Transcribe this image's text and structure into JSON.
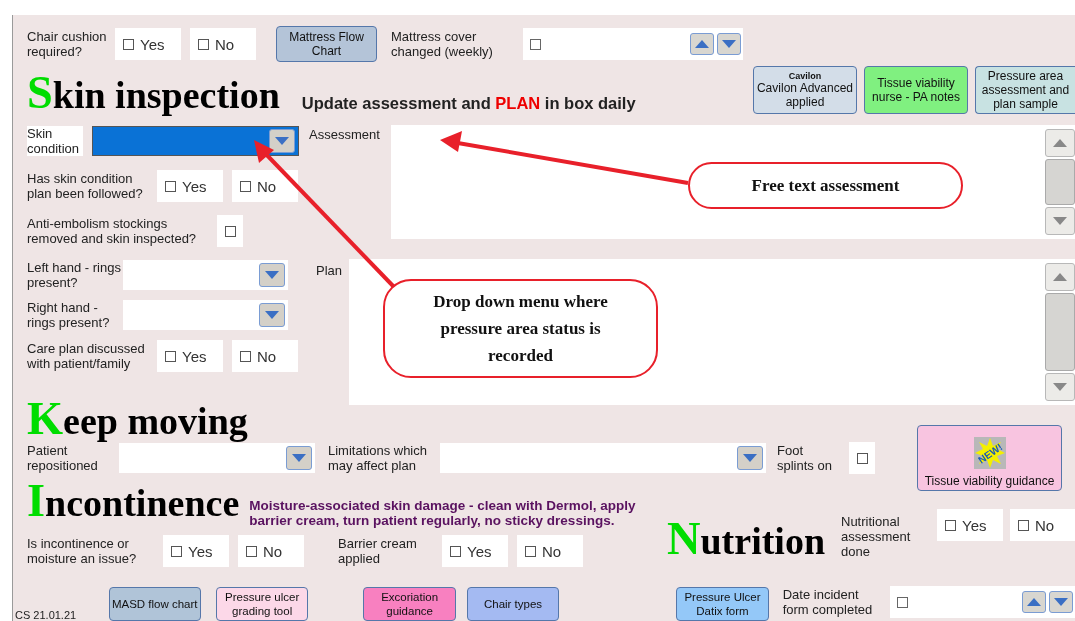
{
  "chair_cushion": {
    "label": "Chair cushion required?",
    "options": [
      {
        "label": "Yes",
        "checked": false
      },
      {
        "label": "No",
        "checked": false
      }
    ]
  },
  "mattress_flow_button": "Mattress Flow Chart",
  "mattress_cover": {
    "label": "Mattress cover changed (weekly)",
    "checked": false
  },
  "skin_inspection": {
    "heading": "Skin inspection",
    "instruction": {
      "before": "Update assessment and",
      "highlight": "PLAN",
      "after": "in box daily"
    }
  },
  "skin_buttons": [
    {
      "kind": "logo",
      "logo_text": "Cavilon",
      "label": "Cavilon Advanced applied",
      "color": "#d3dde8"
    },
    {
      "kind": "plain",
      "label": "Tissue viability nurse - PA notes",
      "color": "#80f080"
    },
    {
      "kind": "plain",
      "label": "Pressure area assessment and plan sample",
      "color": "#c8e2e2"
    }
  ],
  "skin_fields": [
    {
      "kind": "dropdown",
      "label": "Skin condition",
      "highlighted": true
    },
    {
      "kind": "yes_no",
      "label": "Has skin condition plan been followed?",
      "options": [
        {
          "label": "Yes",
          "checked": false
        },
        {
          "label": "No",
          "checked": false
        }
      ]
    },
    {
      "kind": "checkbox",
      "label": "Anti-embolism stockings removed and skin inspected?",
      "checked": false
    },
    {
      "kind": "dropdown",
      "label": "Left hand - rings present?",
      "highlighted": false
    },
    {
      "kind": "dropdown",
      "label": "Right hand - rings present?",
      "highlighted": false
    },
    {
      "kind": "yes_no",
      "label": "Care plan discussed with patient/family",
      "options": [
        {
          "label": "Yes",
          "checked": false
        },
        {
          "label": "No",
          "checked": false
        }
      ]
    }
  ],
  "assessment": {
    "label": "Assessment"
  },
  "plan": {
    "label": "Plan"
  },
  "keep_moving": {
    "heading": "Keep moving",
    "fields": [
      {
        "kind": "dropdown",
        "label": "Patient repositioned"
      },
      {
        "kind": "dropdown",
        "label": "Limitations which may affect plan"
      },
      {
        "kind": "checkbox",
        "label": "Foot splints on",
        "checked": false
      }
    ],
    "guidance_button": {
      "badge": "NEW!",
      "label": "Tissue viability guidance"
    }
  },
  "incontinence": {
    "heading": "Incontinence",
    "note": "Moisture-associated skin damage - clean with Dermol, apply barrier cream, turn patient regularly, no sticky dressings.",
    "fields": [
      {
        "label": "Is incontinence or moisture an issue?",
        "options": [
          {
            "label": "Yes",
            "checked": false
          },
          {
            "label": "No",
            "checked": false
          }
        ]
      },
      {
        "label": "Barrier cream applied",
        "options": [
          {
            "label": "Yes",
            "checked": false
          },
          {
            "label": "No",
            "checked": false
          }
        ]
      }
    ]
  },
  "nutrition": {
    "heading": "Nutrition",
    "field": {
      "label": "Nutritional assessment done",
      "options": [
        {
          "label": "Yes",
          "checked": false
        },
        {
          "label": "No",
          "checked": false
        }
      ]
    }
  },
  "bottom_buttons": [
    {
      "label": "MASD flow chart",
      "color": "#b0c4d8"
    },
    {
      "label": "Pressure ulcer grading tool",
      "color": "#fcd8e8"
    },
    {
      "label": "Excoriation guidance",
      "color": "#f880c0"
    },
    {
      "label": "Chair types",
      "color": "#a4baf2"
    },
    {
      "label": "Pressure Ulcer Datix form",
      "color": "#94c8f8"
    }
  ],
  "date_incident": {
    "label": "Date incident form completed",
    "checked": false
  },
  "footer_code": "CS 21.01.21",
  "callouts": [
    {
      "text": "Free text assessment"
    },
    {
      "text": "Drop down menu where pressure area status is recorded"
    }
  ]
}
